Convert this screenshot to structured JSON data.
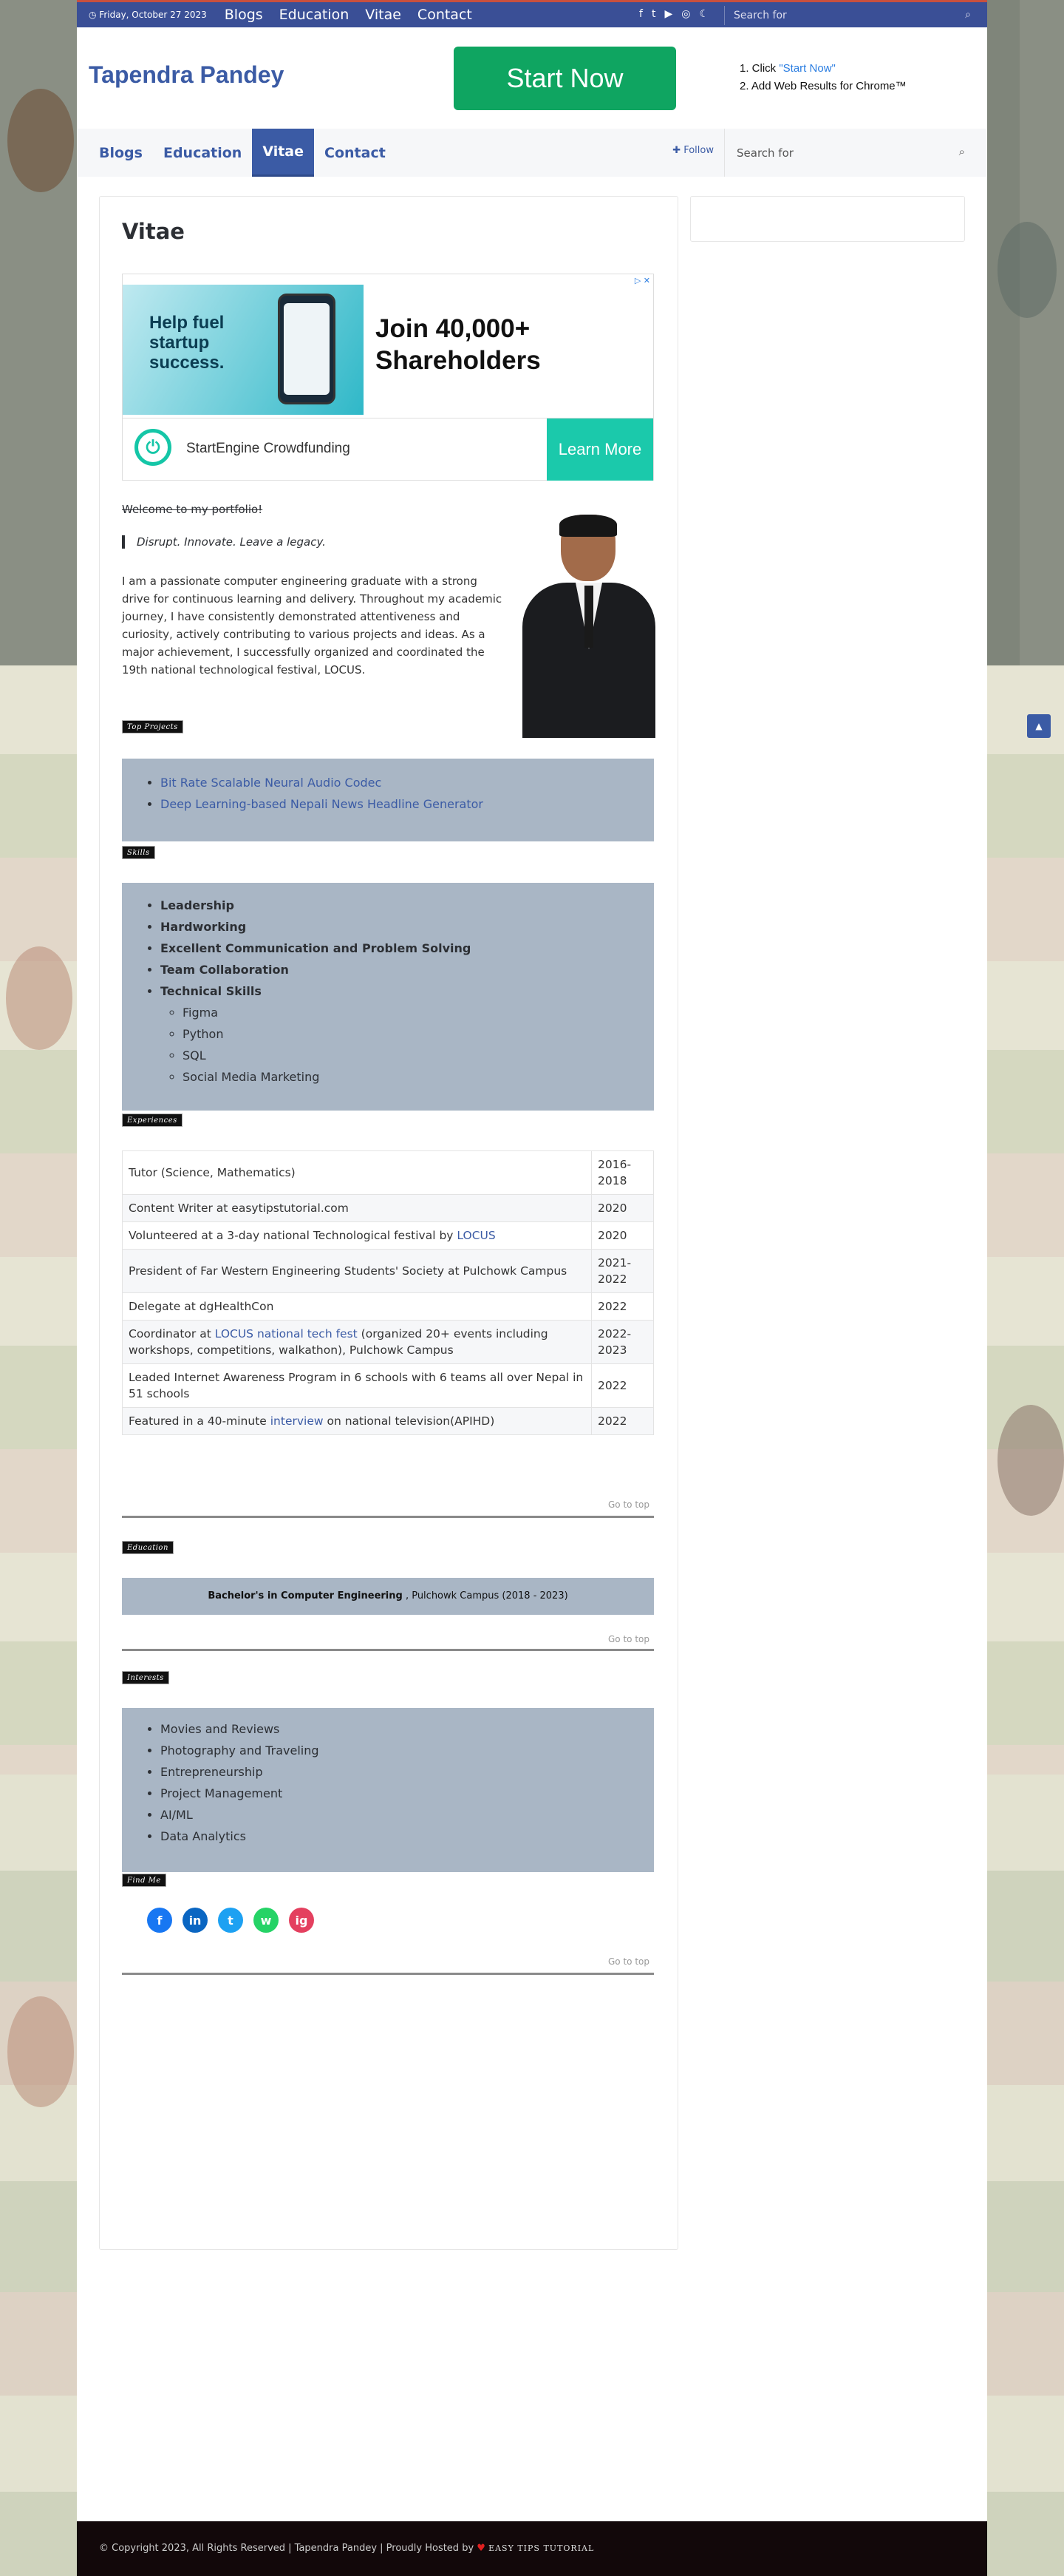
{
  "topbar": {
    "date": "Friday, October 27 2023",
    "nav": [
      "Blogs",
      "Education",
      "Vitae",
      "Contact"
    ],
    "search_placeholder": "Search for"
  },
  "header": {
    "logo": "Tapendra Pandey",
    "ad_button": "Start Now",
    "step1_prefix": "1. Click ",
    "step1_link": "\"Start Now\"",
    "step2": "2. Add Web Results for Chrome™"
  },
  "mainnav": {
    "items": [
      "Blogs",
      "Education",
      "Vitae",
      "Contact"
    ],
    "follow": "Follow",
    "search_placeholder": "Search for"
  },
  "page": {
    "title": "Vitae",
    "welcome": "Welcome to my portfolio!",
    "quote": "Disrupt. Innovate. Leave a legacy.",
    "bio": "I am a passionate computer engineering graduate with a strong drive for continuous learning and delivery. Throughout my academic journey, I have consistently demonstrated attentiveness and curiosity, actively contributing to various projects and ideas. As a major achievement, I successfully organized and coordinated the 19th national technological festival, LOCUS."
  },
  "ad": {
    "image_text": "Help fuel startup success.",
    "headline": "Join 40,000+ Shareholders",
    "brand": "StartEngine Crowdfunding",
    "cta": "Learn More"
  },
  "sections": {
    "projects_label": "Top Projects",
    "skills_label": "Skills",
    "experiences_label": "Experiences",
    "education_label": "Education",
    "interests_label": "Interests",
    "findme_label": "Find Me",
    "goto_top": "Go to top"
  },
  "projects": [
    "Bit Rate Scalable Neural Audio Codec",
    "Deep Learning-based Nepali News Headline Generator"
  ],
  "skills": [
    "Leadership",
    "Hardworking",
    "Excellent Communication and Problem Solving",
    "Team Collaboration",
    "Technical Skills"
  ],
  "technical_skills": [
    "Figma",
    "Python",
    "SQL",
    "Social Media Marketing"
  ],
  "experiences": [
    {
      "pre": "Tutor (Science, Mathematics)",
      "link": "",
      "post": "",
      "year": "2016-2018"
    },
    {
      "pre": "Content Writer at easytipstutorial.com",
      "link": "",
      "post": "",
      "year": "2020"
    },
    {
      "pre": "Volunteered at a 3-day national Technological festival by ",
      "link": "LOCUS",
      "post": "",
      "year": "2020"
    },
    {
      "pre": "President of Far Western Engineering Students' Society at Pulchowk Campus",
      "link": "",
      "post": "",
      "year": "2021-2022"
    },
    {
      "pre": "Delegate at dgHealthCon",
      "link": "",
      "post": "",
      "year": "2022"
    },
    {
      "pre": "Coordinator at ",
      "link": "LOCUS national tech fest",
      "post": " (organized 20+ events including workshops, competitions, walkathon), Pulchowk Campus",
      "year": "2022-2023"
    },
    {
      "pre": "Leaded Internet Awareness Program in 6 schools with 6 teams all over Nepal in 51 schools",
      "link": "",
      "post": "",
      "year": "2022"
    },
    {
      "pre": "Featured in a 40-minute ",
      "link": "interview",
      "post": " on national television(APIHD)",
      "year": "2022"
    }
  ],
  "education": {
    "degree": "Bachelor's in Computer Engineering",
    "detail": " , Pulchowk Campus (2018 - 2023)"
  },
  "interests": [
    "Movies and Reviews",
    "Photography and Traveling",
    "Entrepreneurship",
    "Project Management",
    "AI/ML",
    "Data Analytics"
  ],
  "social": [
    {
      "name": "facebook-icon",
      "glyph": "f",
      "color": "#1877f2"
    },
    {
      "name": "linkedin-icon",
      "glyph": "in",
      "color": "#0a66c2"
    },
    {
      "name": "twitter-icon",
      "glyph": "t",
      "color": "#1da1f2"
    },
    {
      "name": "whatsapp-icon",
      "glyph": "w",
      "color": "#25d366"
    },
    {
      "name": "instagram-icon",
      "glyph": "ig",
      "color": "#e4405f"
    }
  ],
  "footer": {
    "text": "© Copyright 2023, All Rights Reserved  |  Tapendra Pandey | Proudly Hosted by",
    "brand": "EASY TIPS TUTORIAL"
  },
  "colors": {
    "accent": "#3b5ba5",
    "cta_green": "#0fa561",
    "box": "#a9b6c5"
  }
}
